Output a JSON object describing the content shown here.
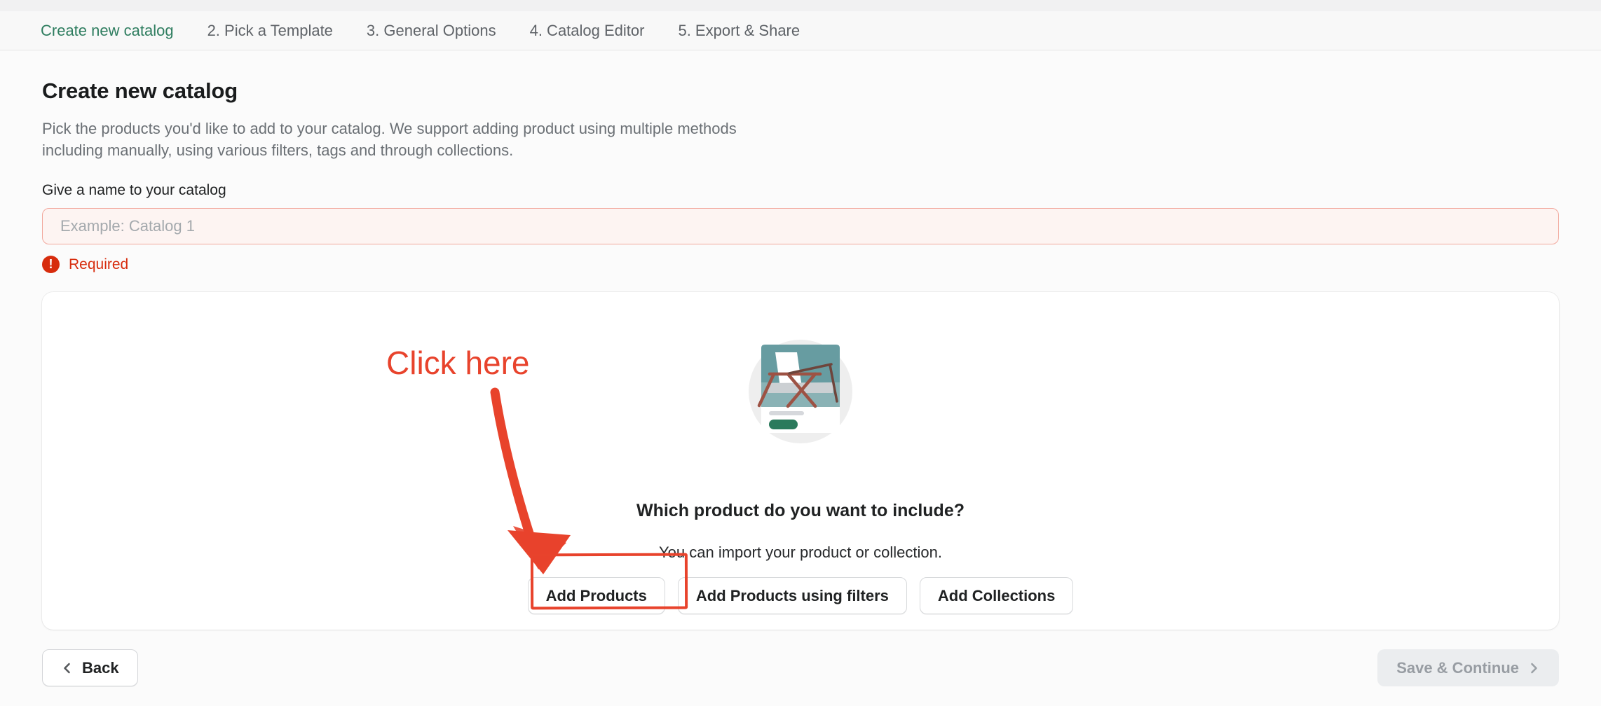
{
  "colors": {
    "accent-green": "#2e7d5f",
    "error-red": "#d72c0d",
    "annotation-red": "#e8432c",
    "input-bg": "#fdf4f2",
    "input-border": "#f2a89d"
  },
  "steps": {
    "items": [
      {
        "label": "Create new catalog",
        "active": true
      },
      {
        "label": "2. Pick a Template",
        "active": false
      },
      {
        "label": "3. General Options",
        "active": false
      },
      {
        "label": "4. Catalog Editor",
        "active": false
      },
      {
        "label": "5. Export & Share",
        "active": false
      }
    ]
  },
  "page": {
    "title": "Create new catalog",
    "description_line1": "Pick the products you'd like to add to your catalog. We support adding product using multiple methods",
    "description_line2": "including manually, using various filters, tags and through collections."
  },
  "catalog_name": {
    "label": "Give a name to your catalog",
    "placeholder": "Example: Catalog 1",
    "value": "",
    "error": "Required"
  },
  "product_picker": {
    "question": "Which product do you want to include?",
    "hint": "You can import your product or collection.",
    "buttons": [
      "Add Products",
      "Add Products using filters",
      "Add Collections"
    ]
  },
  "annotation": {
    "label": "Click here"
  },
  "footer": {
    "back_label": "Back",
    "save_label": "Save & Continue"
  },
  "icons": {
    "error": "!"
  }
}
